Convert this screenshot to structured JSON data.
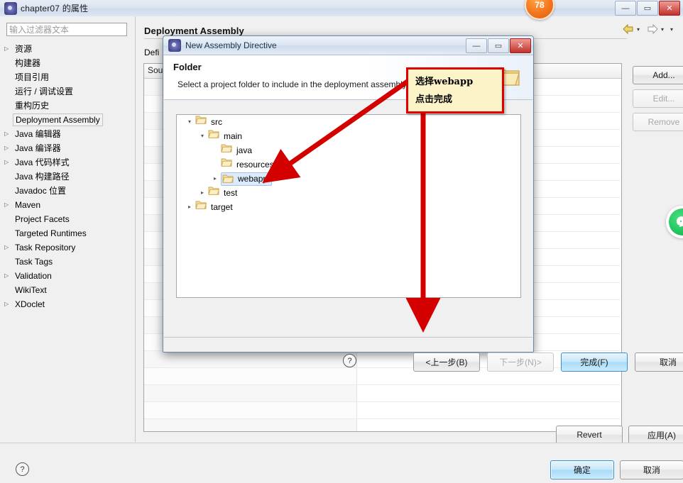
{
  "window": {
    "title": "chapter07 的属性",
    "icon": "eclipse-icon",
    "minimize": "—",
    "maximize": "▭",
    "close": "✕"
  },
  "badge": {
    "label": "78"
  },
  "filter": {
    "placeholder": "输入过滤器文本",
    "value": ""
  },
  "sidebar": {
    "items": [
      {
        "label": "资源",
        "expandable": true,
        "selected": false
      },
      {
        "label": "构建器",
        "expandable": false,
        "selected": false
      },
      {
        "label": "项目引用",
        "expandable": false,
        "selected": false
      },
      {
        "label": "运行 / 调试设置",
        "expandable": false,
        "selected": false
      },
      {
        "label": "重构历史",
        "expandable": false,
        "selected": false
      },
      {
        "label": "Deployment Assembly",
        "expandable": false,
        "selected": true
      },
      {
        "label": "Java 编辑器",
        "expandable": true,
        "selected": false
      },
      {
        "label": "Java 编译器",
        "expandable": true,
        "selected": false
      },
      {
        "label": "Java 代码样式",
        "expandable": true,
        "selected": false
      },
      {
        "label": "Java 构建路径",
        "expandable": false,
        "selected": false
      },
      {
        "label": "Javadoc 位置",
        "expandable": false,
        "selected": false
      },
      {
        "label": "Maven",
        "expandable": true,
        "selected": false
      },
      {
        "label": "Project Facets",
        "expandable": false,
        "selected": false
      },
      {
        "label": "Targeted Runtimes",
        "expandable": false,
        "selected": false
      },
      {
        "label": "Task Repository",
        "expandable": true,
        "selected": false
      },
      {
        "label": "Task Tags",
        "expandable": false,
        "selected": false
      },
      {
        "label": "Validation",
        "expandable": true,
        "selected": false
      },
      {
        "label": "WikiText",
        "expandable": false,
        "selected": false
      },
      {
        "label": "XDoclet",
        "expandable": true,
        "selected": false
      }
    ]
  },
  "main": {
    "page_title": "Deployment Assembly",
    "define_label": "Defi",
    "table": {
      "columns": [
        "Sou",
        ""
      ],
      "rows": [
        [
          "",
          ""
        ],
        [
          "",
          ""
        ],
        [
          "",
          ""
        ],
        [
          "",
          ""
        ],
        [
          "",
          ""
        ],
        [
          "",
          ""
        ],
        [
          "",
          ""
        ],
        [
          "",
          ""
        ],
        [
          "",
          ""
        ],
        [
          "",
          ""
        ],
        [
          "",
          ""
        ],
        [
          "",
          ""
        ],
        [
          "",
          ""
        ],
        [
          "",
          ""
        ],
        [
          "",
          ""
        ],
        [
          "",
          ""
        ],
        [
          "",
          ""
        ],
        [
          "",
          ""
        ],
        [
          "",
          ""
        ],
        [
          "",
          ""
        ],
        [
          "",
          ""
        ]
      ]
    },
    "side_buttons": [
      {
        "label": "Add...",
        "enabled": true
      },
      {
        "label": "Edit...",
        "enabled": false
      },
      {
        "label": "Remove",
        "enabled": false
      }
    ],
    "revert_label": "Revert",
    "apply_label": "应用(A)",
    "nav": {
      "back_icon": "back-arrow-icon",
      "forward_icon": "forward-arrow-icon",
      "chevron": "▾"
    }
  },
  "footer": {
    "help_icon": "?",
    "ok_label": "确定",
    "cancel_label": "取消"
  },
  "dialog": {
    "title": "New Assembly Directive",
    "icon": "eclipse-icon",
    "minimize": "—",
    "maximize": "▭",
    "close": "✕",
    "heading": "Folder",
    "description": "Select a project folder to include in the deployment assembly.",
    "tree": [
      {
        "label": "src",
        "indent": 0,
        "twisty": "▾",
        "selected": false
      },
      {
        "label": "main",
        "indent": 1,
        "twisty": "▾",
        "selected": false
      },
      {
        "label": "java",
        "indent": 2,
        "twisty": "",
        "selected": false
      },
      {
        "label": "resources",
        "indent": 2,
        "twisty": "",
        "selected": false
      },
      {
        "label": "webapp",
        "indent": 2,
        "twisty": "▸",
        "selected": true
      },
      {
        "label": "test",
        "indent": 1,
        "twisty": "▸",
        "selected": false
      },
      {
        "label": "target",
        "indent": 0,
        "twisty": "▸",
        "selected": false
      }
    ],
    "help_icon": "?",
    "buttons": [
      {
        "label": "<上一步(B)",
        "enabled": true,
        "default": false
      },
      {
        "label": "下一步(N)>",
        "enabled": false,
        "default": false
      },
      {
        "label": "完成(F)",
        "enabled": true,
        "default": true
      },
      {
        "label": "取消",
        "enabled": true,
        "default": false
      }
    ]
  },
  "annotations": {
    "callout_line1": "选择webapp",
    "callout_line2": "点击完成",
    "callout_bg": "#fcf3c8",
    "callout_border": "#e00000",
    "arrow_color": "#d40000"
  },
  "widget": {
    "green_icon": "wechat-icon"
  }
}
